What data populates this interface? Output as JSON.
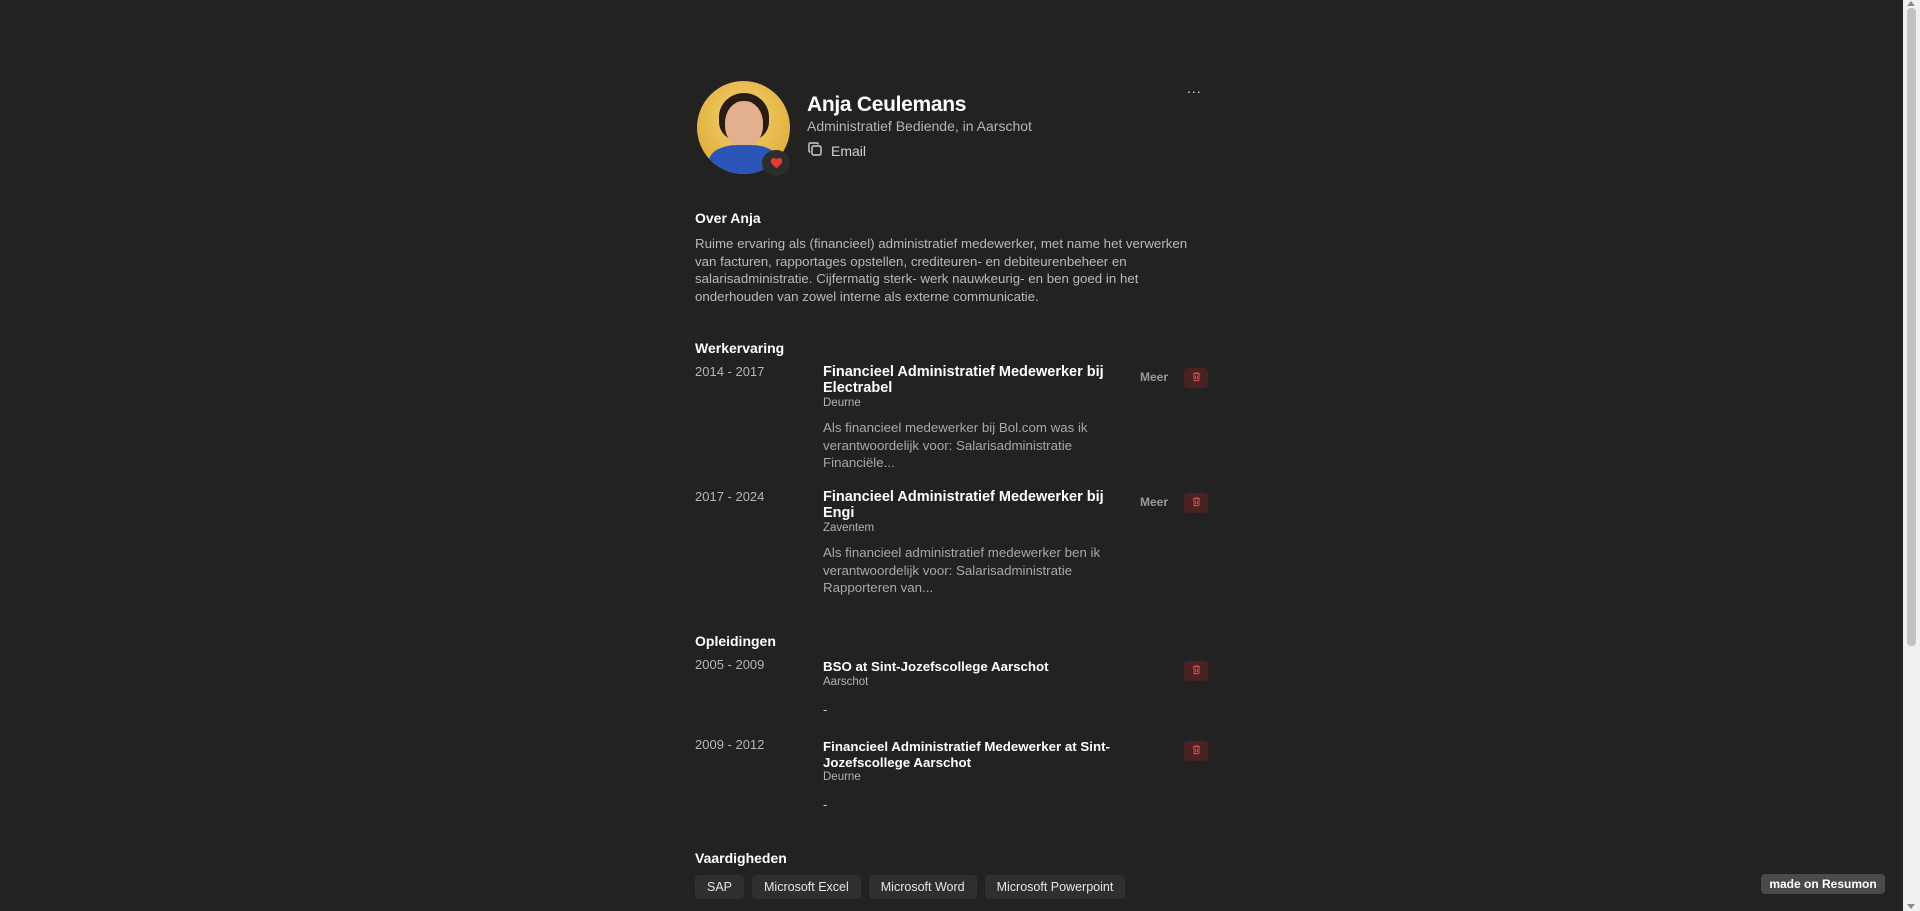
{
  "profile": {
    "name": "Anja Ceulemans",
    "subtitle": "Administratief Bediende, in Aarschot",
    "email_label": "Email",
    "menu_label": "..."
  },
  "about": {
    "title": "Over Anja",
    "text": "Ruime ervaring als (financieel) administratief medewerker, met name het verwerken van facturen, rapportages opstellen, crediteuren- en debiteurenbeheer en salarisadministratie. Cijfermatig sterk- werk nauwkeurig- en ben goed in het onderhouden van zowel interne als externe communicatie."
  },
  "work": {
    "title": "Werkervaring",
    "more_label": "Meer",
    "items": [
      {
        "years": "2014 - 2017",
        "title": "Financieel Administratief Medewerker bij Electrabel",
        "location": "Deurne",
        "description": "Als financieel medewerker bij Bol.com was ik verantwoordelijk voor: Salarisadministratie Financiële..."
      },
      {
        "years": "2017 - 2024",
        "title": "Financieel Administratief Medewerker bij Engi",
        "location": "Zaventem",
        "description": "Als financieel administratief medewerker ben ik verantwoordelijk voor: Salarisadministratie Rapporteren van..."
      }
    ]
  },
  "education": {
    "title": "Opleidingen",
    "items": [
      {
        "years": "2005 - 2009",
        "title": "BSO at Sint-Jozefscollege Aarschot",
        "location": "Aarschot",
        "detail": "-"
      },
      {
        "years": "2009 - 2012",
        "title": "Financieel Administratief Medewerker at Sint-Jozefscollege Aarschot",
        "location": "Deurne",
        "detail": "-"
      }
    ]
  },
  "skills": {
    "title": "Vaardigheden",
    "items": [
      "SAP",
      "Microsoft Excel",
      "Microsoft Word",
      "Microsoft Powerpoint"
    ]
  },
  "footer": {
    "badge": "made on Resumon"
  },
  "colors": {
    "background": "#222222",
    "heart": "#e53935",
    "trash_bg": "#4a2222",
    "trash_icon": "#d9534f"
  },
  "icons": {
    "copy": "copy-icon",
    "heart": "heart-icon",
    "trash": "trash-icon"
  }
}
